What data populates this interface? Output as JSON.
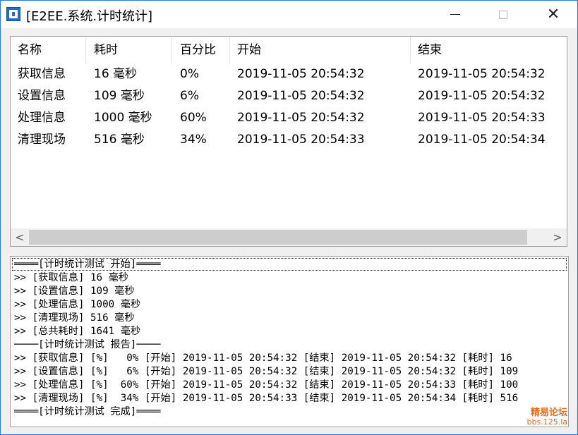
{
  "window": {
    "title": "[E2EE.系统.计时统计]",
    "icon": "app-icon"
  },
  "listview": {
    "columns": [
      "名称",
      "耗时",
      "百分比",
      "开始",
      "结束"
    ],
    "rows": [
      [
        "获取信息",
        "16 毫秒",
        "0%",
        "2019-11-05 20:54:32",
        "2019-11-05 20:54:32"
      ],
      [
        "设置信息",
        "109 毫秒",
        "6%",
        "2019-11-05 20:54:32",
        "2019-11-05 20:54:32"
      ],
      [
        "处理信息",
        "1000 毫秒",
        "60%",
        "2019-11-05 20:54:32",
        "2019-11-05 20:54:33"
      ],
      [
        "清理现场",
        "516 毫秒",
        "34%",
        "2019-11-05 20:54:33",
        "2019-11-05 20:54:34"
      ]
    ],
    "scroll_left_glyph": "<",
    "scroll_right_glyph": ">"
  },
  "log": {
    "lines": [
      "════[计时统计测试 开始]════",
      ">> [获取信息] 16 毫秒",
      ">> [设置信息] 109 毫秒",
      ">> [处理信息] 1000 毫秒",
      ">> [清理现场] 516 毫秒",
      ">> [总共耗时] 1641 毫秒",
      "────[计时统计测试 报告]────",
      ">> [获取信息] [%]   0% [开始] 2019-11-05 20:54:32 [结束] 2019-11-05 20:54:32 [耗时] 16",
      ">> [设置信息] [%]   6% [开始] 2019-11-05 20:54:32 [结束] 2019-11-05 20:54:32 [耗时] 109",
      ">> [处理信息] [%]  60% [开始] 2019-11-05 20:54:32 [结束] 2019-11-05 20:54:33 [耗时] 100",
      ">> [清理现场] [%]  34% [开始] 2019-11-05 20:54:33 [结束] 2019-11-05 20:54:34 [耗时] 516",
      "════[计时统计测试 完成]════"
    ]
  },
  "watermark": {
    "line1": "精易论坛",
    "line2": "bbs.125.la"
  },
  "colors": {
    "border_accent": "#2b79d6",
    "watermark": "#e56a1f"
  }
}
